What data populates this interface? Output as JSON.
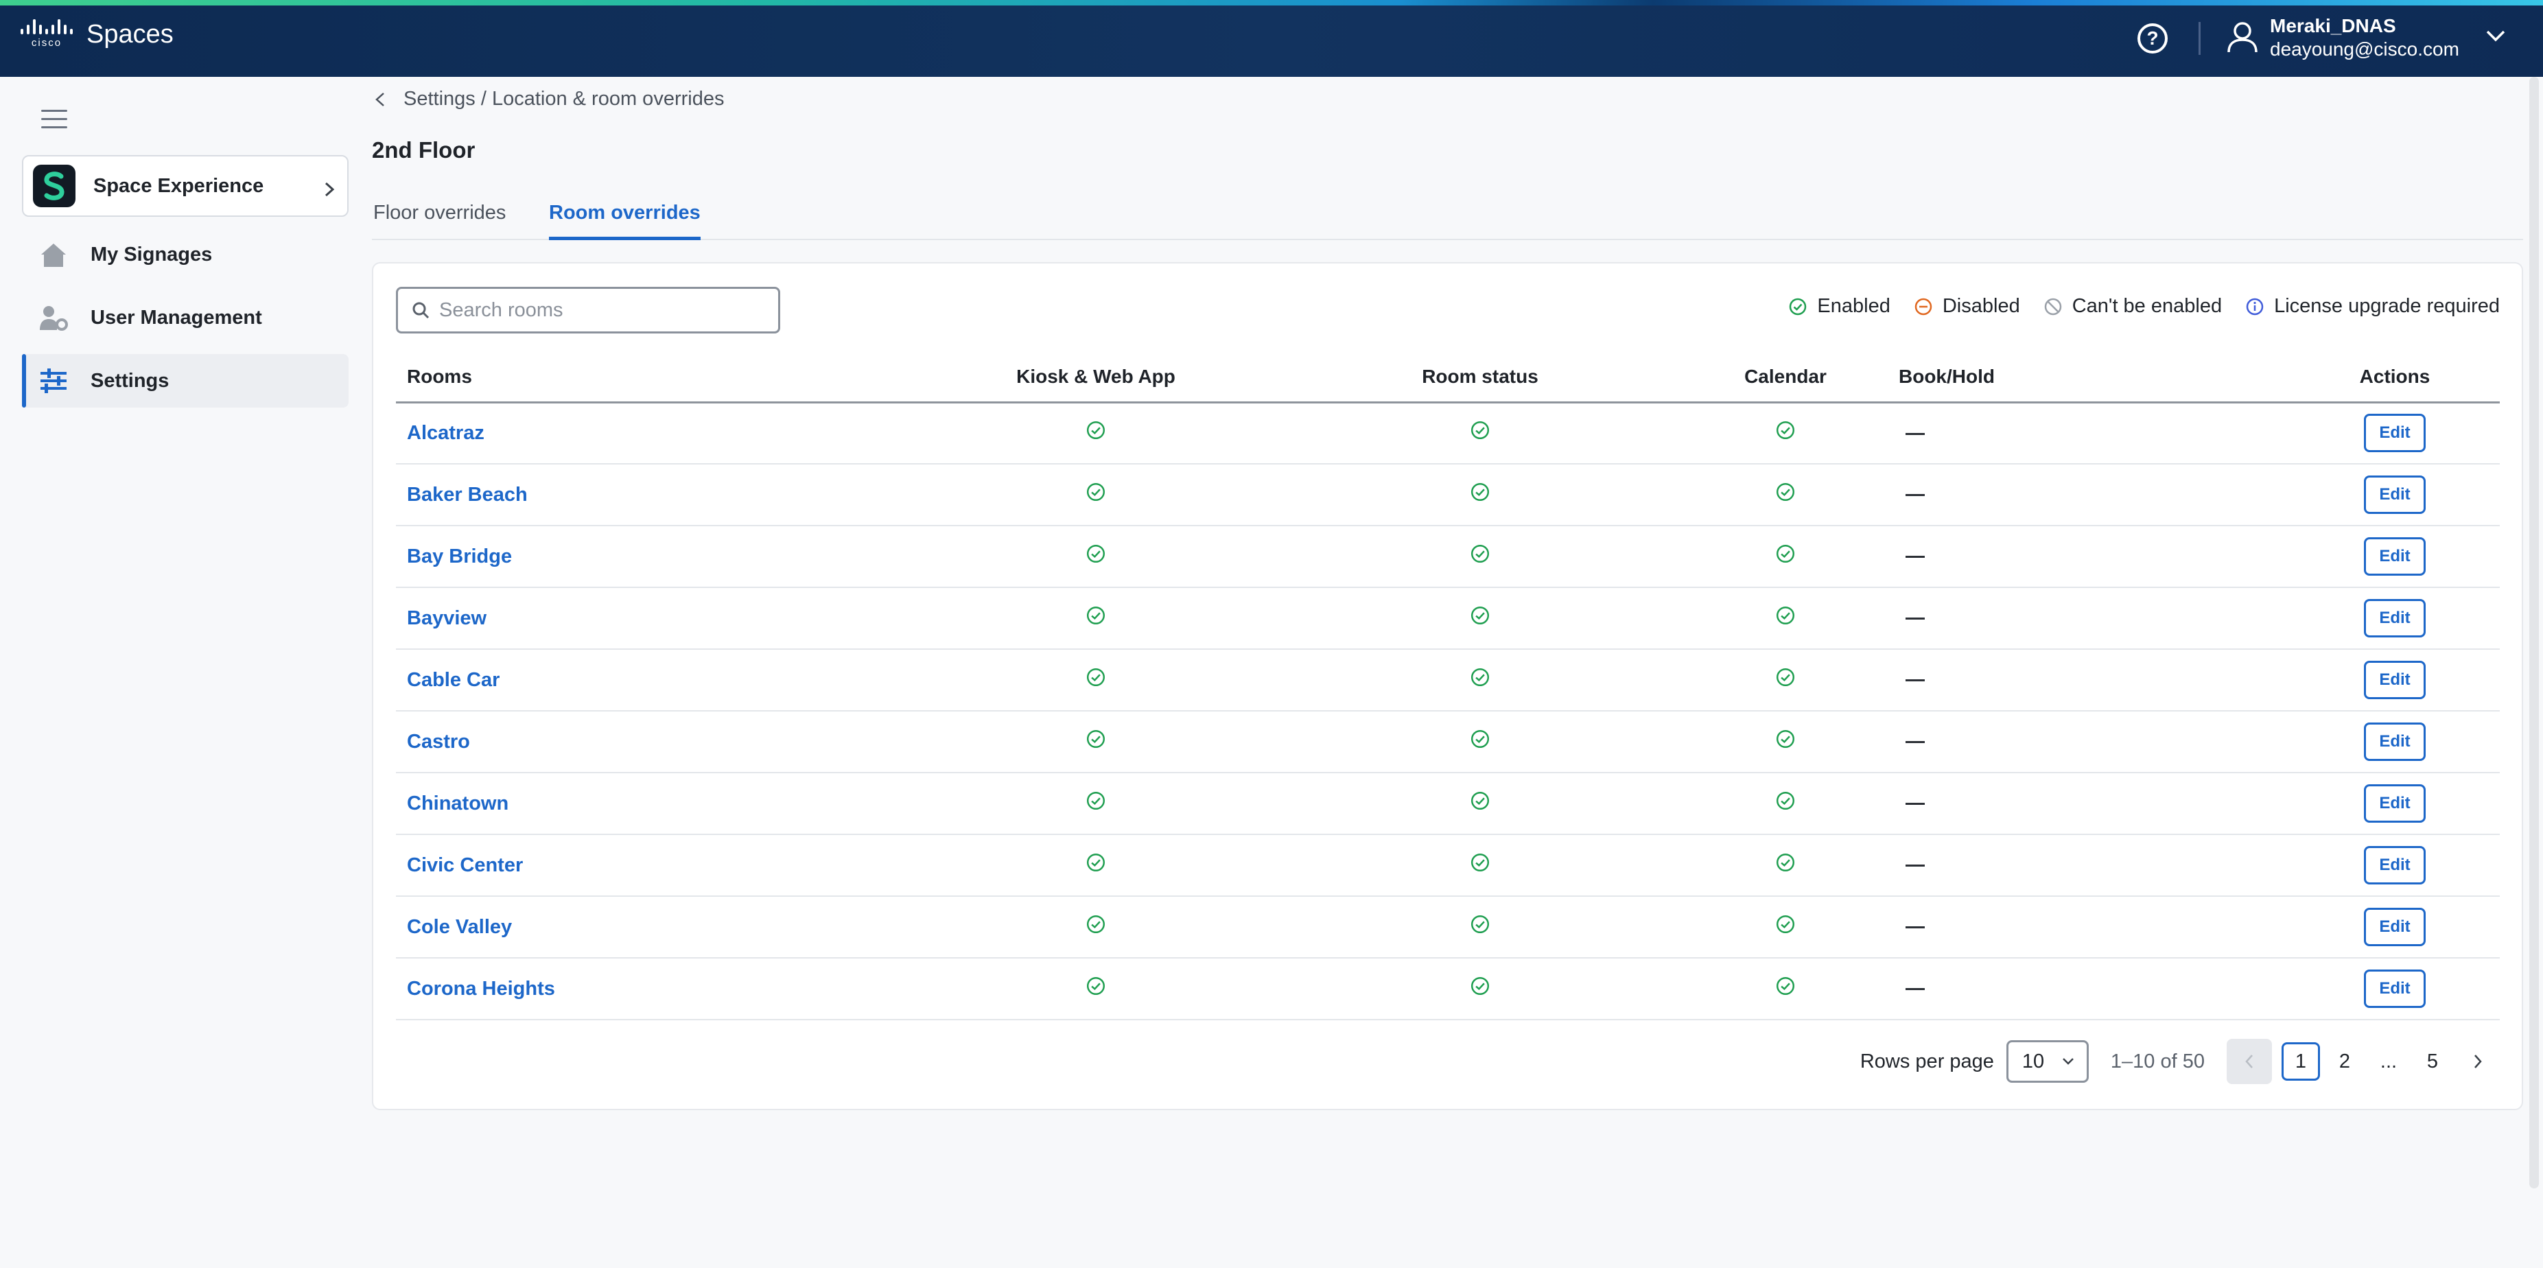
{
  "app": {
    "logo_text": "cisco",
    "name": "Spaces"
  },
  "user": {
    "name": "Meraki_DNAS",
    "email": "deayoung@cisco.com"
  },
  "sidebar": {
    "app_card": {
      "label": "Space Experience"
    },
    "items": [
      {
        "label": "My Signages",
        "icon": "home-icon"
      },
      {
        "label": "User Management",
        "icon": "user-gear-icon"
      },
      {
        "label": "Settings",
        "icon": "sliders-icon",
        "active": true
      }
    ]
  },
  "breadcrumb": "Settings / Location & room overrides",
  "page_title": "2nd Floor",
  "tabs": [
    {
      "label": "Floor overrides"
    },
    {
      "label": "Room overrides",
      "active": true
    }
  ],
  "search": {
    "placeholder": "Search rooms",
    "value": ""
  },
  "legend": [
    {
      "label": "Enabled",
      "color": "#1e9e4f"
    },
    {
      "label": "Disabled",
      "color": "#e0671f"
    },
    {
      "label": "Can't be enabled",
      "color": "#9aa0a8"
    },
    {
      "label": "License upgrade required",
      "color": "#3f5bd9"
    }
  ],
  "table": {
    "headers": [
      "Rooms",
      "Kiosk & Web App",
      "Room status",
      "Calendar",
      "Book/Hold",
      "Actions"
    ],
    "edit_label": "Edit",
    "rows": [
      {
        "room": "Alcatraz"
      },
      {
        "room": "Baker Beach"
      },
      {
        "room": "Bay Bridge"
      },
      {
        "room": "Bayview"
      },
      {
        "room": "Cable Car"
      },
      {
        "room": "Castro"
      },
      {
        "room": "Chinatown"
      },
      {
        "room": "Civic Center"
      },
      {
        "room": "Cole Valley"
      },
      {
        "room": "Corona Heights"
      }
    ]
  },
  "pagination": {
    "rows_per_page_label": "Rows per page",
    "rows_per_page": "10",
    "range": "1–10 of 50",
    "pages": [
      "1",
      "2",
      "...",
      "5"
    ],
    "current": "1"
  },
  "colors": {
    "accent": "#1d67c9",
    "header_bg": "#0d2a52",
    "enabled": "#1e9e4f"
  }
}
